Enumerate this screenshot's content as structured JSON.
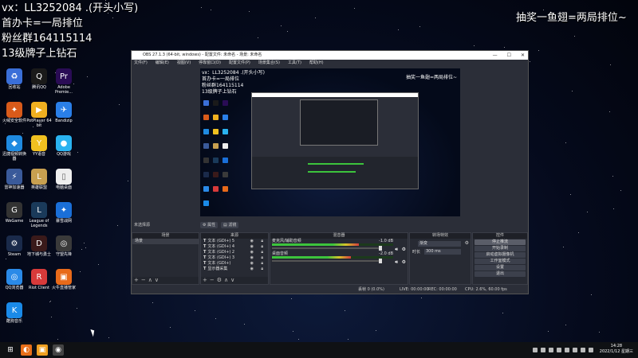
{
  "overlay": {
    "line1": "vx：LL3252084 .(开头小写)",
    "line2": "首办卡=一局排位",
    "line3": "粉丝群164115114",
    "line4": "13级牌子上钻石",
    "right": "抽奖一鱼翅=两局排位~"
  },
  "desktop_icons": [
    {
      "label": "回收站",
      "color": "#3a6fd8",
      "glyph": "♻"
    },
    {
      "label": "腾讯QQ",
      "color": "#1a1a1a",
      "glyph": "Q"
    },
    {
      "label": "Adobe Premie...",
      "color": "#2a0c55",
      "glyph": "Pr"
    },
    {
      "label": "火绒安全软件",
      "color": "#d85a1a",
      "glyph": "✦"
    },
    {
      "label": "PotPlayer 64 bit",
      "color": "#f0b020",
      "glyph": "▶"
    },
    {
      "label": "Bandizip",
      "color": "#2a7fe8",
      "glyph": "✈"
    },
    {
      "label": "迅捷视频转换器",
      "color": "#1f8ae0",
      "glyph": "◆"
    },
    {
      "label": "YY语音",
      "color": "#f0c020",
      "glyph": "Y"
    },
    {
      "label": "QQ游戏",
      "color": "#2ab3f0",
      "glyph": "●"
    },
    {
      "label": "雷神加速器",
      "color": "#3a5a9a",
      "glyph": "⚡"
    },
    {
      "label": "英雄联盟",
      "color": "#c8a050",
      "glyph": "L"
    },
    {
      "label": "电脑桌面",
      "color": "#eeeeee",
      "glyph": "▯"
    },
    {
      "label": "WeGame",
      "color": "#333333",
      "glyph": "G"
    },
    {
      "label": "League of Legends",
      "color": "#1a3a5a",
      "glyph": "L"
    },
    {
      "label": "暴雪战网",
      "color": "#1a6fd8",
      "glyph": "✦"
    },
    {
      "label": "Steam",
      "color": "#1a2a4a",
      "glyph": "⚙"
    },
    {
      "label": "地下城与勇士",
      "color": "#3a1a1a",
      "glyph": "D"
    },
    {
      "label": "守望先锋",
      "color": "#3a3a3a",
      "glyph": "◎"
    },
    {
      "label": "QQ浏览器",
      "color": "#2a8ae8",
      "glyph": "◎"
    },
    {
      "label": "Riot Client",
      "color": "#d83a3a",
      "glyph": "R"
    },
    {
      "label": "火牛直播管家",
      "color": "#e86a1a",
      "glyph": "▣"
    },
    {
      "label": "酷狗音乐",
      "color": "#1a8ae8",
      "glyph": "K"
    }
  ],
  "obs": {
    "title": "OBS 27.1.3 (64-bit, windows) - 配置文件: 未命名 - 场景: 未命名",
    "menu": [
      "文件(F)",
      "编辑(E)",
      "视图(V)",
      "停靠窗口(D)",
      "配置文件(P)",
      "场景集合(S)",
      "工具(T)",
      "帮助(H)"
    ],
    "toolbar": {
      "no_source": "未选择源",
      "props": "属性",
      "filters": "滤镜"
    },
    "docks": {
      "scenes": {
        "header": "场景",
        "items": [
          "场景"
        ]
      },
      "sources": {
        "header": "来源",
        "items": [
          "文本 (GDI+) 5",
          "文本 (GDI+) 4",
          "文本 (GDI+) 2",
          "文本 (GDI+) 3",
          "文本 (GDI+)",
          "显示器采集"
        ]
      },
      "mixer": {
        "header": "混音器",
        "channels": [
          {
            "name": "麦克风/辅助音频",
            "db": "-1.0 dB",
            "level": 0.72
          },
          {
            "name": "桌面音频",
            "db": "-2.0 dB",
            "level": 0.65
          }
        ]
      },
      "transitions": {
        "header": "转场特效",
        "type": "渐变",
        "duration_label": "时长",
        "duration": "300 ms"
      },
      "controls": {
        "header": "控件",
        "buttons": [
          "停止推流",
          "开始录制",
          "启动虚拟摄像机",
          "工作室模式",
          "设置",
          "退出"
        ]
      }
    },
    "status": {
      "drop": "丢帧 0 (0.0%)",
      "live": "LIVE: 00:00:00",
      "rec": "REC: 00:00:00",
      "cpu": "CPU: 2.6%, 60.00 fps"
    }
  },
  "nested_preview": {
    "title": "OBS 27.1.3 (64-bit, windows)",
    "line1": "vx：LL3252084 .(开头小写)",
    "line2": "首办卡=一局排位",
    "line3": "粉丝群164115114",
    "line4": "13级牌子上钻石",
    "right": "抽奖一鱼翅=两局排位~"
  },
  "taskbar": {
    "time": "14:28",
    "date": "2022/1/12 星期三"
  }
}
